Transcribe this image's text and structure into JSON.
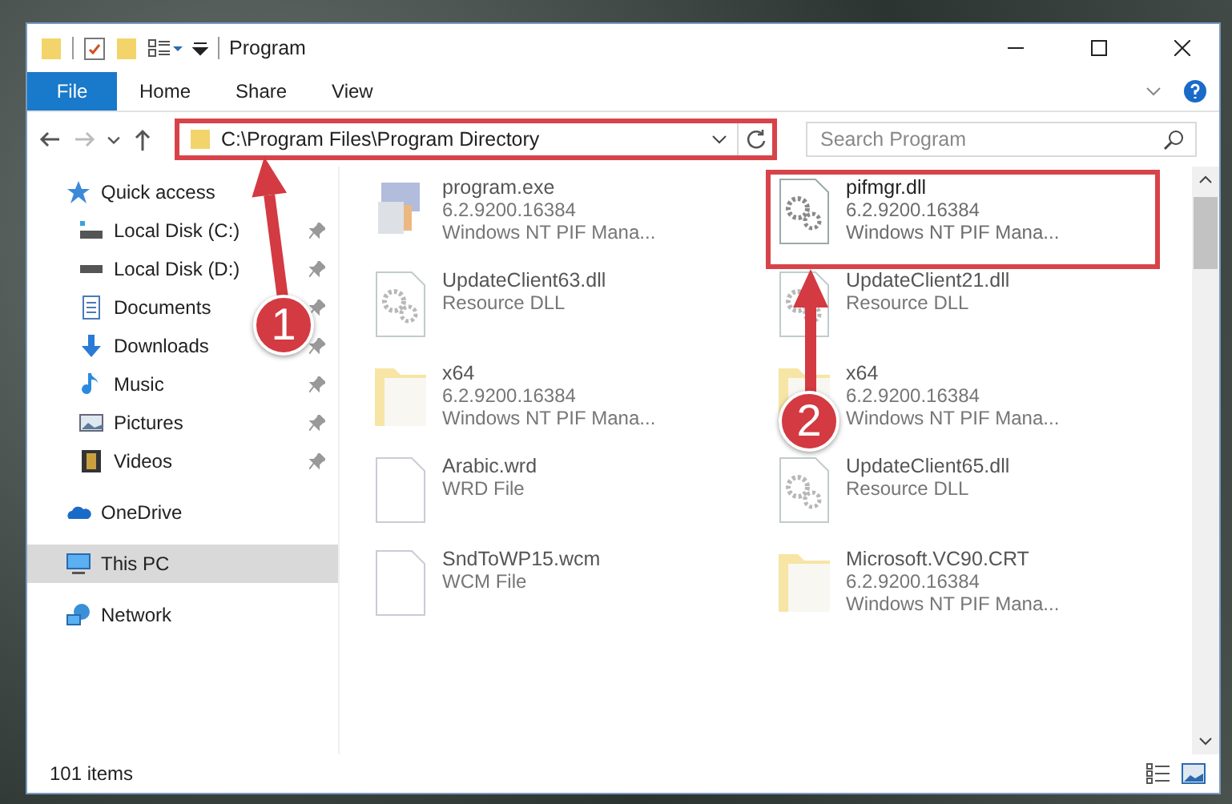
{
  "window": {
    "title": "Program"
  },
  "ribbon_tabs": [
    {
      "label": "File",
      "selected": true
    },
    {
      "label": "Home",
      "selected": false
    },
    {
      "label": "Share",
      "selected": false
    },
    {
      "label": "View",
      "selected": false
    }
  ],
  "address_bar": {
    "path": "C:\\Program Files\\Program Directory",
    "highlighted": true
  },
  "search": {
    "placeholder": "Search Program"
  },
  "sidebar": {
    "items": [
      {
        "label": "Quick access",
        "kind": "star",
        "selected": false,
        "children": [
          {
            "label": "Local Disk (C:)",
            "kind": "drive-c",
            "pinned": true,
            "selected": false
          },
          {
            "label": "Local Disk (D:)",
            "kind": "drive",
            "pinned": true,
            "selected": false
          },
          {
            "label": "Documents",
            "kind": "documents",
            "pinned": true,
            "selected": false
          },
          {
            "label": "Downloads",
            "kind": "downloads",
            "pinned": true,
            "selected": false
          },
          {
            "label": "Music",
            "kind": "music",
            "pinned": true,
            "selected": false
          },
          {
            "label": "Pictures",
            "kind": "pictures",
            "pinned": true,
            "selected": false
          },
          {
            "label": "Videos",
            "kind": "videos",
            "pinned": true,
            "selected": false
          }
        ]
      },
      {
        "label": "OneDrive",
        "kind": "cloud",
        "selected": false
      },
      {
        "label": "This PC",
        "kind": "pc",
        "selected": true
      },
      {
        "label": "Network",
        "kind": "network",
        "selected": false
      }
    ]
  },
  "files": [
    {
      "name": "program.exe",
      "kind": "exe",
      "lines": [
        "6.2.9200.16384",
        "Windows NT PIF Mana..."
      ],
      "blurred": true,
      "highlighted": false
    },
    {
      "name": "pifmgr.dll",
      "kind": "dll",
      "lines": [
        "6.2.9200.16384",
        "Windows NT PIF Mana..."
      ],
      "blurred": false,
      "highlighted": true
    },
    {
      "name": "UpdateClient63.dll",
      "kind": "dll",
      "lines": [
        "Resource DLL"
      ],
      "blurred": true,
      "highlighted": false
    },
    {
      "name": "UpdateClient21.dll",
      "kind": "dll",
      "lines": [
        "Resource DLL"
      ],
      "blurred": true,
      "highlighted": false
    },
    {
      "name": "x64",
      "kind": "folder",
      "lines": [
        "6.2.9200.16384",
        "Windows NT PIF Mana..."
      ],
      "blurred": true,
      "highlighted": false
    },
    {
      "name": "x64",
      "kind": "folder",
      "lines": [
        "6.2.9200.16384",
        "Windows NT PIF Mana..."
      ],
      "blurred": true,
      "highlighted": false
    },
    {
      "name": "Arabic.wrd",
      "kind": "file",
      "lines": [
        "WRD File"
      ],
      "blurred": true,
      "highlighted": false
    },
    {
      "name": "UpdateClient65.dll",
      "kind": "dll",
      "lines": [
        "Resource DLL"
      ],
      "blurred": true,
      "highlighted": false
    },
    {
      "name": "SndToWP15.wcm",
      "kind": "file",
      "lines": [
        "WCM File"
      ],
      "blurred": true,
      "highlighted": false
    },
    {
      "name": "Microsoft.VC90.CRT",
      "kind": "folder",
      "lines": [
        "6.2.9200.16384",
        "Windows NT PIF Mana..."
      ],
      "blurred": true,
      "highlighted": false
    }
  ],
  "status_bar": {
    "item_count": "101 items"
  },
  "annotations": [
    {
      "label": "1"
    },
    {
      "label": "2"
    }
  ]
}
